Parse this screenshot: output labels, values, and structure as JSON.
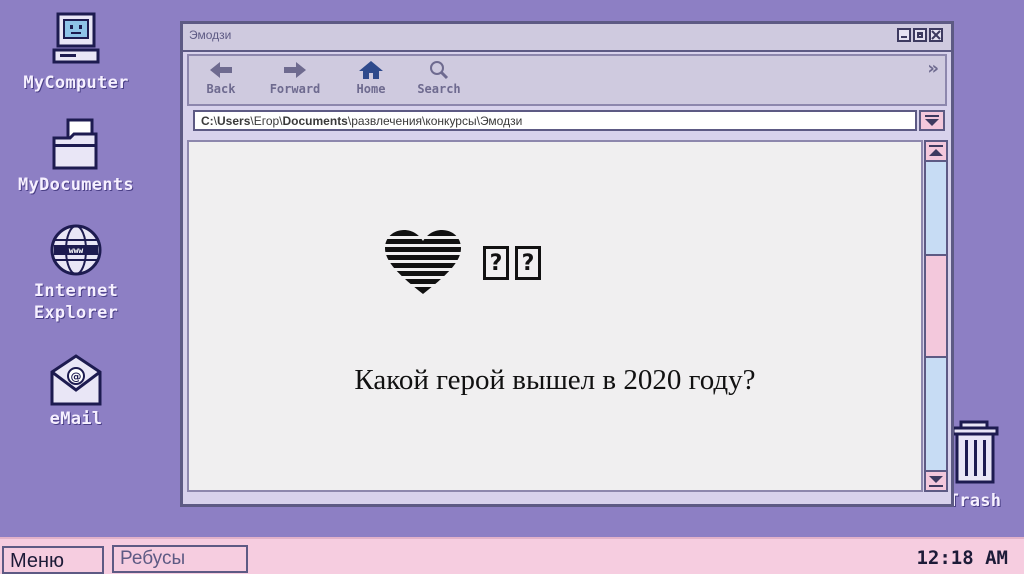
{
  "desktop": {
    "icons": [
      {
        "label": "MyComputer",
        "icon": "computer-icon"
      },
      {
        "label": "MyDocuments",
        "icon": "folder-icon"
      },
      {
        "label": "Internet\nExplorer",
        "icon": "globe-icon"
      },
      {
        "label": "eMail",
        "icon": "mail-icon"
      }
    ],
    "trash": {
      "label": "Trash",
      "icon": "trash-icon"
    }
  },
  "window": {
    "title": "Эмодзи",
    "toolbar": [
      {
        "label": "Back",
        "icon": "back-arrow-icon"
      },
      {
        "label": "Forward",
        "icon": "forward-arrow-icon"
      },
      {
        "label": "Home",
        "icon": "home-icon"
      },
      {
        "label": "Search",
        "icon": "search-icon"
      }
    ],
    "address": {
      "segments": [
        {
          "text": "C:",
          "bold": true
        },
        {
          "text": "\\",
          "bold": false
        },
        {
          "text": "Users",
          "bold": true
        },
        {
          "text": "\\Егор\\",
          "bold": false
        },
        {
          "text": "Documents",
          "bold": true
        },
        {
          "text": "\\развлечения\\конкурсы\\Эмодзи",
          "bold": false
        }
      ]
    },
    "content": {
      "emoji_glyphs": [
        "?",
        "?"
      ],
      "question": "Какой герой вышел в 2020 году?"
    }
  },
  "taskbar": {
    "start_label": "Меню",
    "task_label": "Ребусы",
    "clock": "12:18 AM"
  },
  "colors": {
    "desktop": "#8d7fc4",
    "window_frame": "#5d5a84",
    "pink": "#f6cde0",
    "scroll_track": "#c7dcf4"
  }
}
